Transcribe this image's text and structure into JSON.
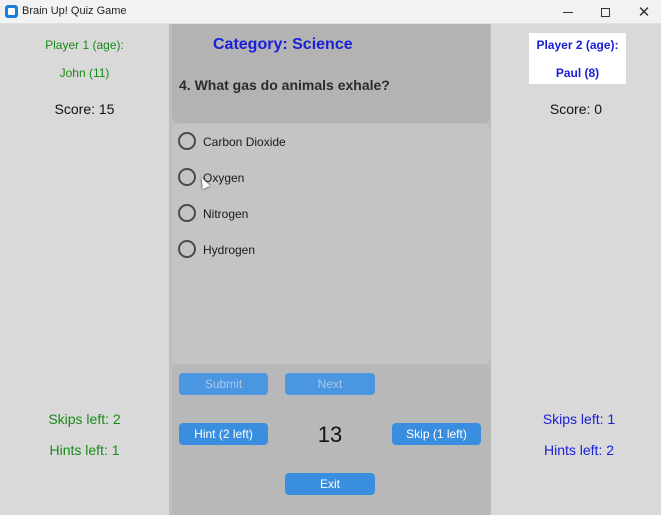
{
  "window": {
    "title": "Brain Up! Quiz Game",
    "minimize_glyph": "—",
    "maximize_glyph": "☐",
    "close_glyph": "✕"
  },
  "player1": {
    "label": "Player 1 (age):",
    "name": "John (11)",
    "score": "Score: 15",
    "skips": "Skips left: 2",
    "hints": "Hints left: 1",
    "color": "#1a8a1a"
  },
  "player2": {
    "label": "Player 2 (age):",
    "name": "Paul (8)",
    "score": "Score: 0",
    "skips": "Skips left: 1",
    "hints": "Hints left: 2",
    "color": "#1a20d6"
  },
  "quiz": {
    "category": "Category: Science",
    "question": "4. What gas do animals exhale?",
    "options": [
      "Carbon Dioxide",
      "Oxygen",
      "Nitrogen",
      "Hydrogen"
    ],
    "timer": "13"
  },
  "buttons": {
    "submit": "Submit",
    "next": "Next",
    "hint": "Hint (2 left)",
    "skip": "Skip (1 left)",
    "exit": "Exit"
  },
  "colors": {
    "button": "#3a8ee0",
    "category": "#1a20d6"
  }
}
